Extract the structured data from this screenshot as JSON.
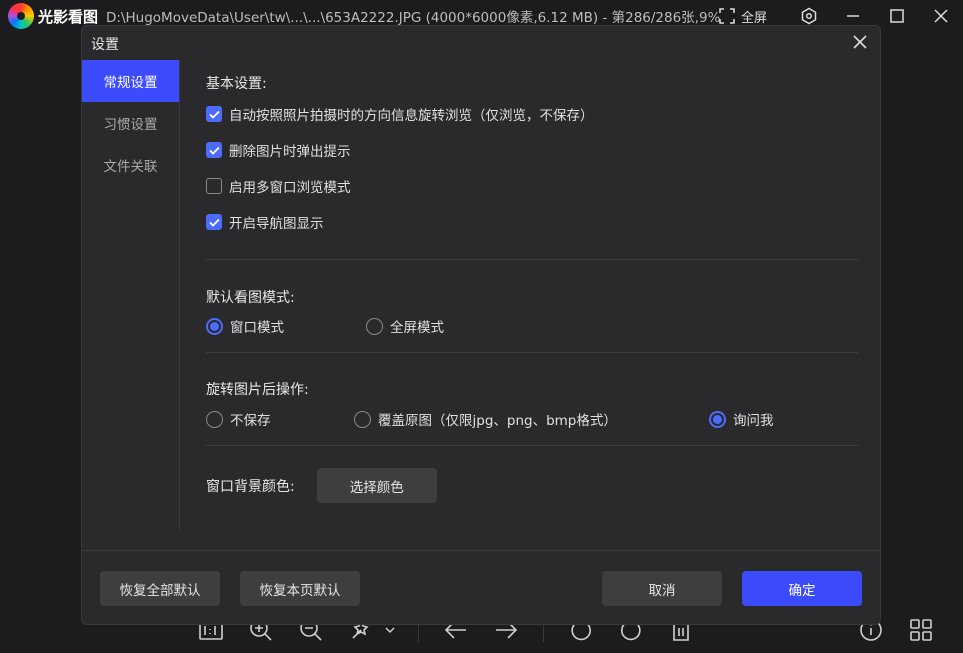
{
  "app": {
    "name": "光影看图",
    "file_info": "D:\\HugoMoveData\\User\\tw\\...\\...\\653A2222.JPG (4000*6000像素,6.12 MB) - 第286/286张,9%",
    "fullscreen_label": "全屏"
  },
  "dialog": {
    "title": "设置",
    "sidebar": [
      {
        "label": "常规设置"
      },
      {
        "label": "习惯设置"
      },
      {
        "label": "文件关联"
      }
    ],
    "basic": {
      "title": "基本设置:",
      "options": [
        {
          "label": "自动按照照片拍摄时的方向信息旋转浏览（仅浏览，不保存）",
          "checked": true
        },
        {
          "label": "删除图片时弹出提示",
          "checked": true
        },
        {
          "label": "启用多窗口浏览模式",
          "checked": false
        },
        {
          "label": "开启导航图显示",
          "checked": true
        }
      ]
    },
    "view_mode": {
      "title": "默认看图模式:",
      "options": [
        {
          "label": "窗口模式",
          "selected": true
        },
        {
          "label": "全屏模式",
          "selected": false
        }
      ]
    },
    "rotate": {
      "title": "旋转图片后操作:",
      "options": [
        {
          "label": "不保存",
          "selected": false
        },
        {
          "label": "覆盖原图（仅限jpg、png、bmp格式）",
          "selected": false
        },
        {
          "label": "询问我",
          "selected": true
        }
      ]
    },
    "background": {
      "title": "窗口背景颜色:",
      "button": "选择颜色"
    },
    "footer": {
      "restore_all": "恢复全部默认",
      "restore_page": "恢复本页默认",
      "cancel": "取消",
      "confirm": "确定"
    }
  },
  "colors": {
    "accent": "#3d4bff",
    "checkbox": "#4d6bff",
    "dialog_bg": "#2a2a2d",
    "window_bg": "#1c1c1e"
  }
}
